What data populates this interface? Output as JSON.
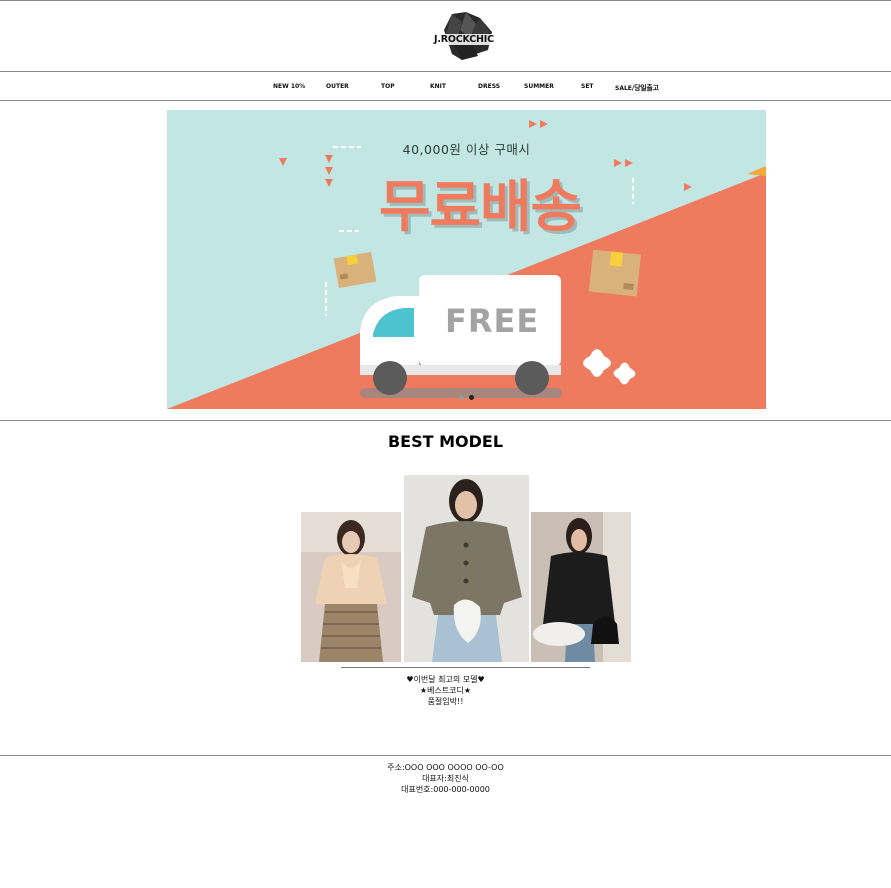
{
  "header": {
    "brand": "J.ROCKCHIC"
  },
  "nav": {
    "items": [
      "NEW 10%",
      "OUTER",
      "TOP",
      "KNIT",
      "DRESS",
      "SUMMER",
      "SET"
    ],
    "sale_label": "SALE/",
    "sale_extra": "당일출고"
  },
  "banner": {
    "subtitle": "40,000원 이상 구매시",
    "title": "무료배송",
    "truck_label": "FREE",
    "colors": {
      "sky": "#c2e6e3",
      "coral": "#ef7b5f",
      "active_dot": "#222222",
      "inactive_dot": "#9a9a9a"
    },
    "slide_count": 2,
    "active_slide": 2
  },
  "best": {
    "title": "BEST MODEL",
    "products": [
      "blouse-look",
      "khaki-jacket-look",
      "black-blazer-look"
    ],
    "caption_lines": [
      "♥이번달 최고의 모델♥",
      "★베스트코디★",
      "품절임박!!"
    ]
  },
  "footer": {
    "address": "주소:OOO OOO OOOO OO-OO",
    "ceo": "대표자:최진식",
    "phone": "대표번호:000-000-0000"
  }
}
